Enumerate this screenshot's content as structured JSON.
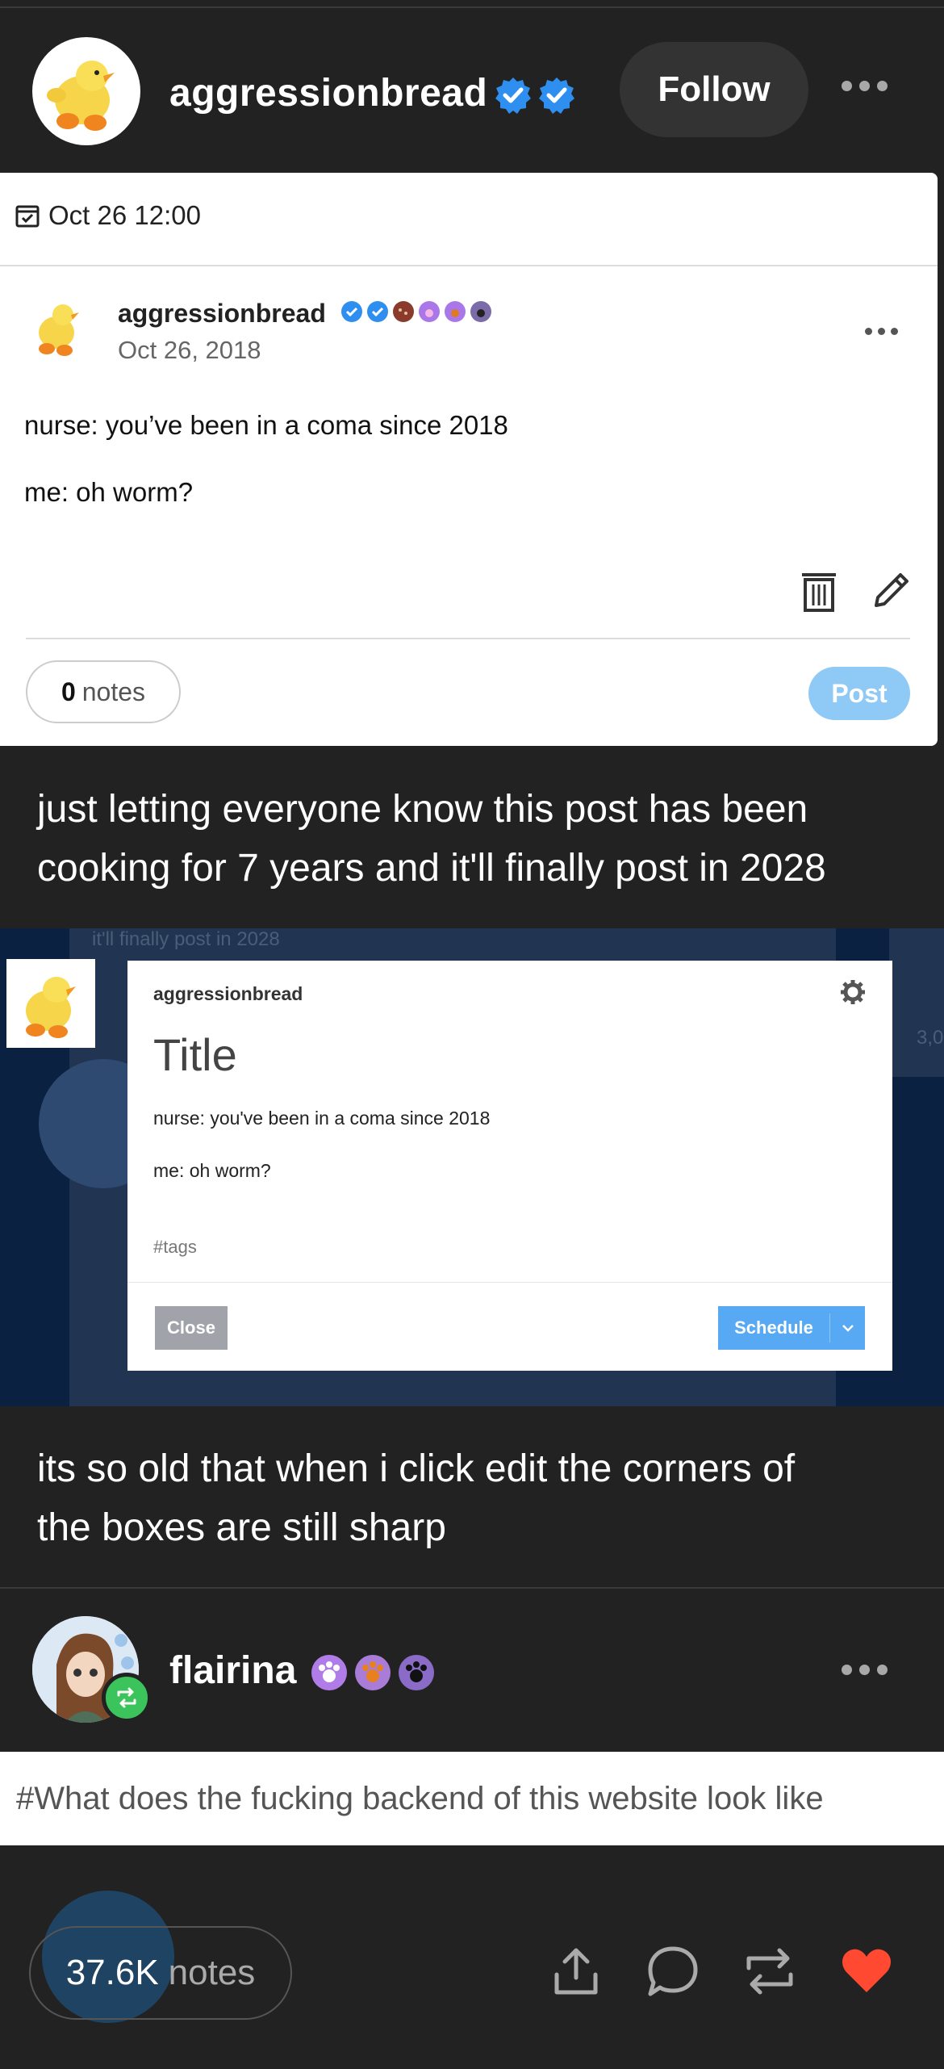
{
  "post": {
    "username": "aggressionbread",
    "follow_label": "Follow"
  },
  "screenshot1": {
    "date": "Oct 26 12:00",
    "username": "aggressionbread",
    "post_date": "Oct 26, 2018",
    "line1": "nurse: you’ve been in a coma since 2018",
    "line2": "me: oh worm?",
    "notes_count": "0",
    "notes_label": "notes",
    "post_button": "Post"
  },
  "caption1": {
    "line1": "just letting everyone know this post has been",
    "line2": "cooking for 7 years and it'll finally post in 2028"
  },
  "screenshot2": {
    "bg_text_top": "it'll finally post in 2028",
    "bg_text_num": "3,0",
    "username": "aggressionbread",
    "title_placeholder": "Title",
    "line1": "nurse: you've been in a coma since 2018",
    "line2": "me: oh worm?",
    "tags_placeholder": "#tags",
    "close_button": "Close",
    "schedule_button": "Schedule"
  },
  "caption2": {
    "line1": "its so old that when i click edit the corners of",
    "line2": "the boxes are still sharp"
  },
  "reblogger": {
    "username": "flairina"
  },
  "tags": {
    "text": "#What does the fucking backend of this website look like"
  },
  "footer": {
    "notes_count": "37.6K",
    "notes_label": "notes"
  },
  "colors": {
    "background": "#222222",
    "verified_blue": "#2e8ff0",
    "like_red": "#ff4930",
    "reblog_green": "#3bc45b",
    "post_button": "#8fc9f6",
    "schedule_button": "#56a9f2"
  },
  "icons": [
    "check-badge-icon",
    "calendar-icon",
    "trash-icon",
    "pencil-icon",
    "gear-icon",
    "chevron-down-icon",
    "reblog-icon",
    "share-icon",
    "comment-icon",
    "heart-icon",
    "more-icon"
  ]
}
